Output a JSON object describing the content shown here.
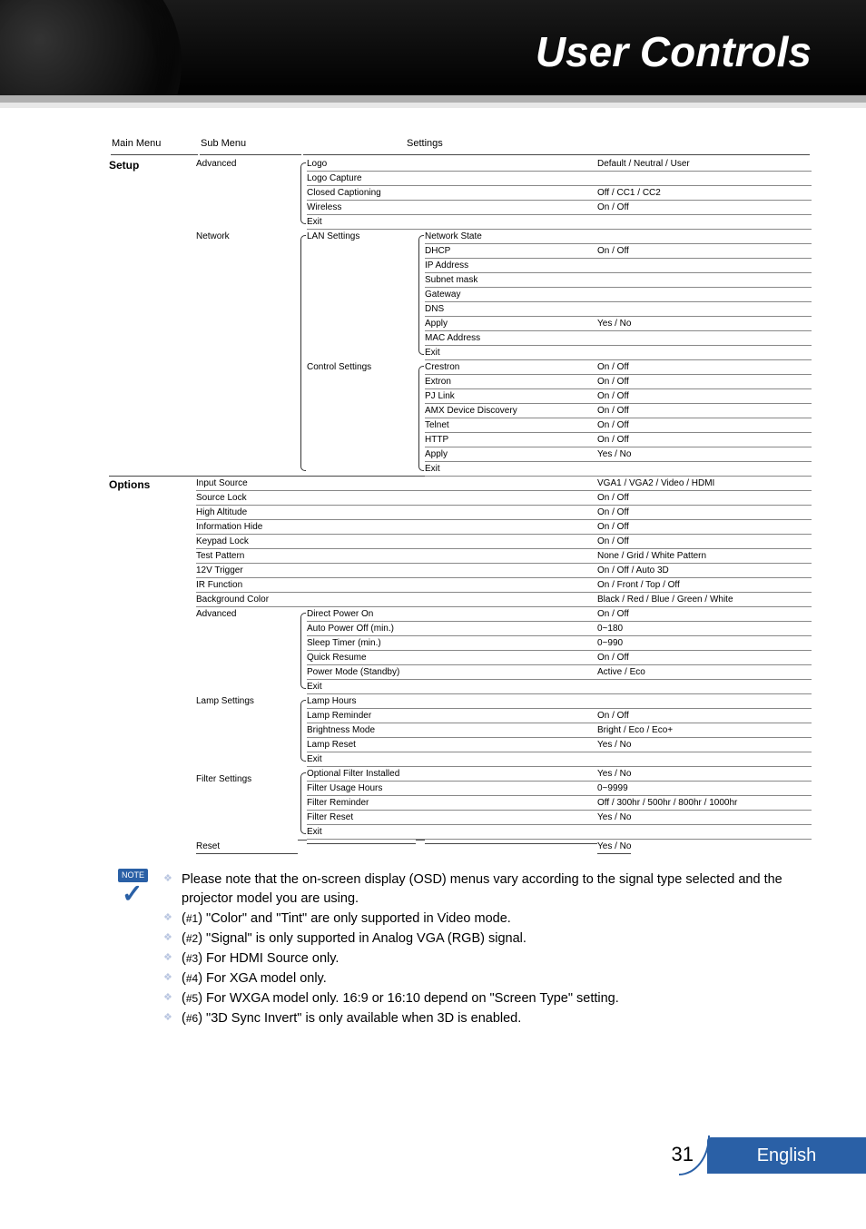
{
  "header": {
    "title": "User Controls"
  },
  "columns": {
    "main": "Main Menu",
    "sub": "Sub Menu",
    "settings": "Settings"
  },
  "setup": {
    "label": "Setup",
    "advanced": {
      "label": "Advanced",
      "rows": [
        {
          "name": "Logo",
          "val": "Default / Neutral / User"
        },
        {
          "name": "Logo Capture",
          "val": ""
        },
        {
          "name": "Closed Captioning",
          "val": "Off / CC1 / CC2"
        },
        {
          "name": "Wireless",
          "val": "On / Off"
        },
        {
          "name": "Exit",
          "val": ""
        }
      ]
    },
    "network": {
      "label": "Network",
      "lan": {
        "label": "LAN Settings",
        "rows": [
          {
            "name": "Network State",
            "val": ""
          },
          {
            "name": "DHCP",
            "val": "On / Off"
          },
          {
            "name": "IP Address",
            "val": ""
          },
          {
            "name": "Subnet mask",
            "val": ""
          },
          {
            "name": "Gateway",
            "val": ""
          },
          {
            "name": "DNS",
            "val": ""
          },
          {
            "name": "Apply",
            "val": "Yes / No"
          },
          {
            "name": "MAC Address",
            "val": ""
          },
          {
            "name": "Exit",
            "val": ""
          }
        ]
      },
      "control": {
        "label": "Control Settings",
        "rows": [
          {
            "name": "Crestron",
            "val": "On / Off"
          },
          {
            "name": "Extron",
            "val": "On / Off"
          },
          {
            "name": "PJ Link",
            "val": "On / Off"
          },
          {
            "name": "AMX Device Discovery",
            "val": "On / Off"
          },
          {
            "name": "Telnet",
            "val": "On / Off"
          },
          {
            "name": "HTTP",
            "val": "On / Off"
          },
          {
            "name": "Apply",
            "val": "Yes / No"
          },
          {
            "name": "Exit",
            "val": ""
          }
        ]
      }
    }
  },
  "options": {
    "label": "Options",
    "plain": [
      {
        "sub": "Input Source",
        "val": "VGA1 / VGA2 / Video / HDMI"
      },
      {
        "sub": "Source Lock",
        "val": "On / Off"
      },
      {
        "sub": "High Altitude",
        "val": "On / Off"
      },
      {
        "sub": "Information Hide",
        "val": "On / Off"
      },
      {
        "sub": "Keypad Lock",
        "val": "On / Off"
      },
      {
        "sub": "Test Pattern",
        "val": "None / Grid / White Pattern"
      },
      {
        "sub": "12V Trigger",
        "val": "On / Off / Auto 3D"
      },
      {
        "sub": "IR Function",
        "val": "On / Front / Top / Off"
      },
      {
        "sub": "Background Color",
        "val": "Black / Red / Blue / Green / White"
      }
    ],
    "advanced": {
      "label": "Advanced",
      "rows": [
        {
          "name": "Direct Power On",
          "val": "On / Off"
        },
        {
          "name": "Auto Power Off (min.)",
          "val": "0~180"
        },
        {
          "name": "Sleep Timer (min.)",
          "val": "0~990"
        },
        {
          "name": "Quick Resume",
          "val": "On / Off"
        },
        {
          "name": "Power Mode (Standby)",
          "val": "Active / Eco"
        },
        {
          "name": "Exit",
          "val": ""
        }
      ]
    },
    "lamp": {
      "label": "Lamp Settings",
      "rows": [
        {
          "name": "Lamp Hours",
          "val": ""
        },
        {
          "name": "Lamp Reminder",
          "val": "On / Off"
        },
        {
          "name": "Brightness Mode",
          "val": "Bright / Eco / Eco+"
        },
        {
          "name": "Lamp Reset",
          "val": "Yes / No"
        },
        {
          "name": "Exit",
          "val": ""
        }
      ]
    },
    "filter": {
      "label": "Filter Settings",
      "rows": [
        {
          "name": "Optional Filter Installed",
          "val": "Yes / No"
        },
        {
          "name": "Filter Usage Hours",
          "val": "0~9999"
        },
        {
          "name": "Filter Reminder",
          "val": "Off / 300hr / 500hr / 800hr / 1000hr"
        },
        {
          "name": "Filter Reset",
          "val": "Yes / No"
        },
        {
          "name": "Exit",
          "val": ""
        }
      ]
    },
    "reset": {
      "sub": "Reset",
      "val": "Yes / No"
    }
  },
  "notes": {
    "badge": "NOTE",
    "items": [
      "Please note that the on-screen display (OSD) menus vary according to the signal type selected and the projector model you are using.",
      "(#1) \"Color\" and \"Tint\" are only supported in Video mode.",
      "(#2) \"Signal\" is only supported in Analog VGA (RGB) signal.",
      "(#3) For HDMI Source only.",
      "(#4) For XGA model only.",
      "(#5) For WXGA model only. 16:9 or 16:10 depend on \"Screen Type\" setting.",
      "(#6) \"3D Sync Invert\" is only available when 3D is enabled."
    ]
  },
  "footer": {
    "page": "31",
    "language": "English"
  }
}
